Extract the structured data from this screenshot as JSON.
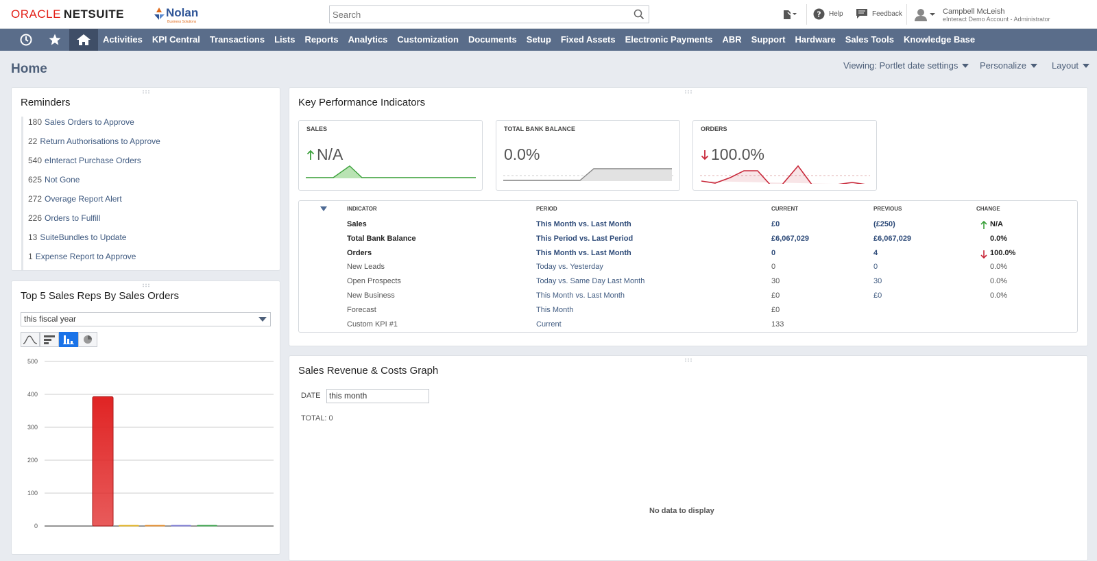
{
  "header": {
    "logo_oracle": "ORACLE",
    "logo_netsuite": "NETSUITE",
    "partner_name": "Nolan",
    "partner_sub": "Business Solutions",
    "search_placeholder": "Search",
    "help_label": "Help",
    "feedback_label": "Feedback",
    "user_name": "Campbell McLeish",
    "user_role": "eInteract Demo Account - Administrator"
  },
  "nav": {
    "items": [
      "Activities",
      "KPI Central",
      "Transactions",
      "Lists",
      "Reports",
      "Analytics",
      "Customization",
      "Documents",
      "Setup",
      "Fixed Assets",
      "Electronic Payments",
      "ABR",
      "Support",
      "Hardware",
      "Sales Tools",
      "Knowledge Base"
    ]
  },
  "page": {
    "title": "Home",
    "viewing": "Viewing: Portlet date settings",
    "personalize": "Personalize",
    "layout": "Layout"
  },
  "reminders": {
    "title": "Reminders",
    "items": [
      {
        "count": "180",
        "label": "Sales Orders to Approve"
      },
      {
        "count": "22",
        "label": "Return Authorisations to Approve"
      },
      {
        "count": "540",
        "label": "eInteract Purchase Orders"
      },
      {
        "count": "625",
        "label": "Not Gone"
      },
      {
        "count": "272",
        "label": "Overage Report Alert"
      },
      {
        "count": "226",
        "label": "Orders to Fulfill"
      },
      {
        "count": "13",
        "label": "SuiteBundles to Update"
      },
      {
        "count": "1",
        "label": "Expense Report to Approve"
      }
    ]
  },
  "top5": {
    "title": "Top 5 Sales Reps By Sales Orders",
    "period": "this fiscal year"
  },
  "chart_data": {
    "type": "bar",
    "title": "",
    "xlabel": "",
    "ylabel": "",
    "ylim": [
      0,
      500
    ],
    "yticks": [
      "0",
      "100",
      "200",
      "300",
      "400",
      "500"
    ],
    "values": [
      393,
      3,
      3,
      3,
      3
    ],
    "colors": [
      "#e02424",
      "#e0b020",
      "#e08a2a",
      "#7a78d0",
      "#3aa04a"
    ],
    "grid": true
  },
  "kpi": {
    "title": "Key Performance Indicators",
    "cards": [
      {
        "label": "SALES",
        "arrow": "up",
        "value": "N/A",
        "color": "#3aa03a"
      },
      {
        "label": "TOTAL BANK BALANCE",
        "arrow": "",
        "value": "0.0%",
        "color": "#888888"
      },
      {
        "label": "ORDERS",
        "arrow": "down",
        "value": "100.0%",
        "color": "#c8283a"
      }
    ],
    "columns": [
      "INDICATOR",
      "PERIOD",
      "CURRENT",
      "PREVIOUS",
      "CHANGE"
    ],
    "rows": [
      {
        "indicator": "Sales",
        "period": "This Month vs. Last Month",
        "current": "£0",
        "previous": "(£250)",
        "arrow": "up",
        "change": "N/A",
        "bold": true
      },
      {
        "indicator": "Total Bank Balance",
        "period": "This Period vs. Last Period",
        "current": "£6,067,029",
        "previous": "£6,067,029",
        "arrow": "",
        "change": "0.0%",
        "bold": true
      },
      {
        "indicator": "Orders",
        "period": "This Month vs. Last Month",
        "current": "0",
        "previous": "4",
        "arrow": "down",
        "change": "100.0%",
        "bold": true
      },
      {
        "indicator": "New Leads",
        "period": "Today vs. Yesterday",
        "current": "0",
        "previous": "0",
        "arrow": "",
        "change": "0.0%",
        "bold": false
      },
      {
        "indicator": "Open Prospects",
        "period": "Today vs. Same Day Last Month",
        "current": "30",
        "previous": "30",
        "arrow": "",
        "change": "0.0%",
        "bold": false
      },
      {
        "indicator": "New Business",
        "period": "This Month vs. Last Month",
        "current": "£0",
        "previous": "£0",
        "arrow": "",
        "change": "0.0%",
        "bold": false
      },
      {
        "indicator": "Forecast",
        "period": "This Month",
        "current": "£0",
        "previous": "",
        "arrow": "",
        "change": "",
        "bold": false
      },
      {
        "indicator": "Custom KPI #1",
        "period": "Current",
        "current": "133",
        "previous": "",
        "arrow": "",
        "change": "",
        "bold": false
      }
    ]
  },
  "revenue": {
    "title": "Sales Revenue & Costs Graph",
    "date_label": "DATE",
    "date_value": "this month",
    "total": "TOTAL: 0",
    "no_data": "No data to display"
  }
}
